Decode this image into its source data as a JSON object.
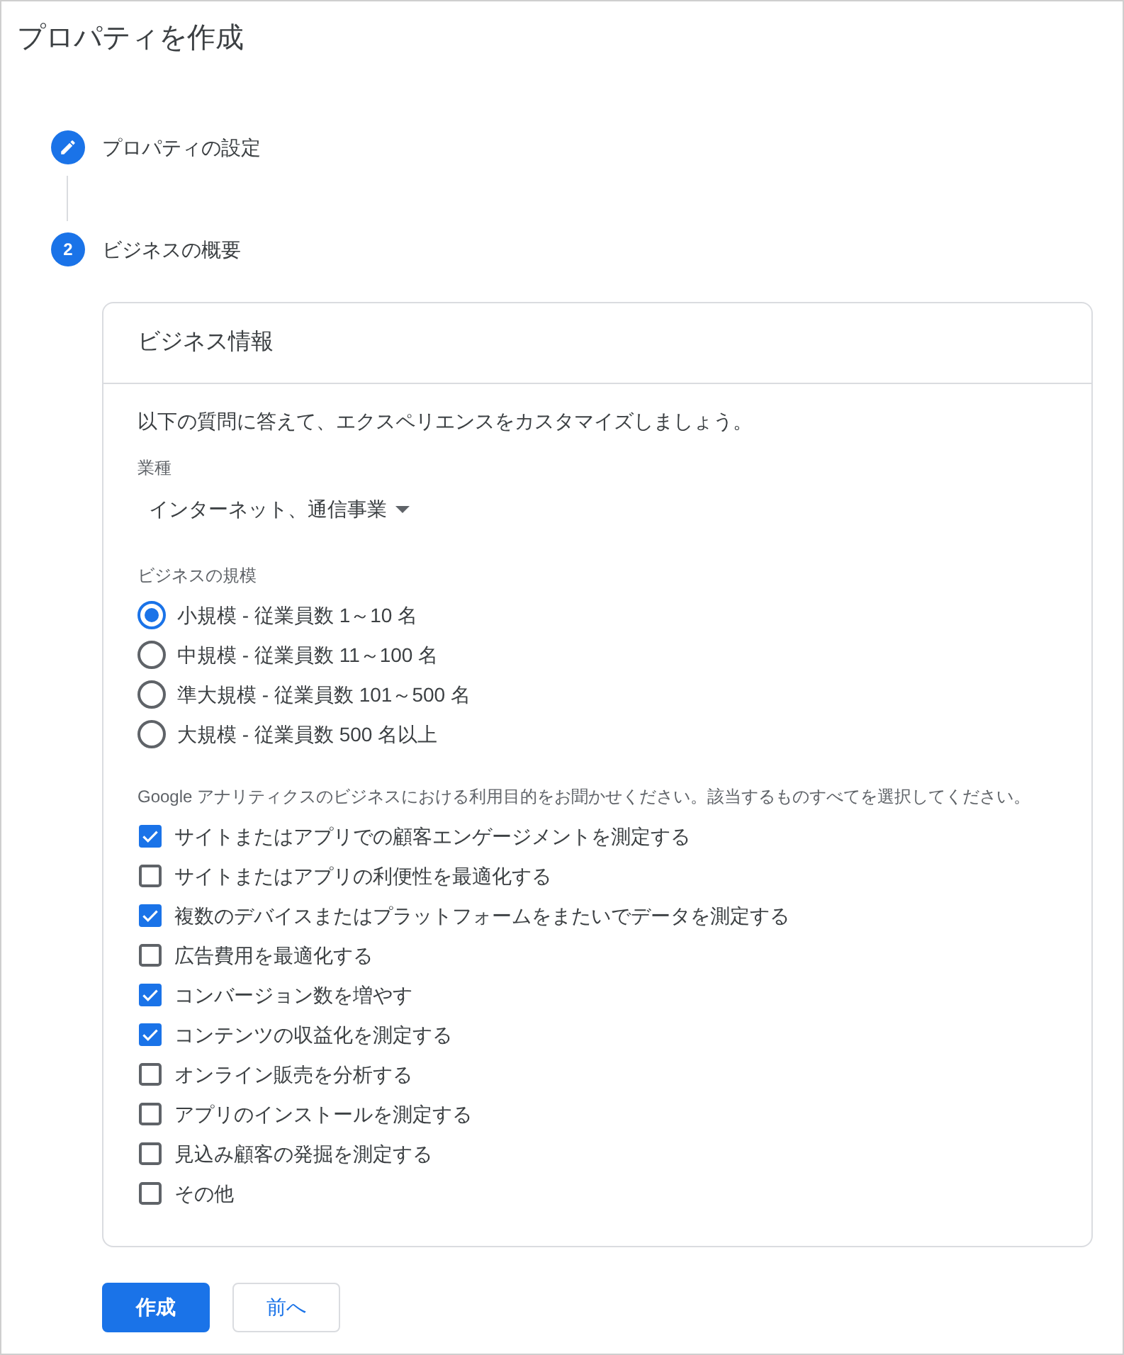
{
  "title": "プロパティを作成",
  "steps": [
    {
      "kind": "edit",
      "label": "プロパティの設定"
    },
    {
      "kind": "number",
      "number": "2",
      "label": "ビジネスの概要"
    }
  ],
  "card": {
    "title": "ビジネス情報",
    "intro": "以下の質問に答えて、エクスペリエンスをカスタマイズしましょう。",
    "industry": {
      "label": "業種",
      "value": "インターネット、通信事業"
    },
    "business_size": {
      "label": "ビジネスの規模",
      "options": [
        {
          "label": "小規模 - 従業員数 1～10 名",
          "selected": true
        },
        {
          "label": "中規模 - 従業員数 11～100 名",
          "selected": false
        },
        {
          "label": "準大規模 - 従業員数 101～500 名",
          "selected": false
        },
        {
          "label": "大規模 - 従業員数 500 名以上",
          "selected": false
        }
      ]
    },
    "purposes": {
      "label": "Google アナリティクスのビジネスにおける利用目的をお聞かせください。該当するものすべてを選択してください。",
      "options": [
        {
          "label": "サイトまたはアプリでの顧客エンゲージメントを測定する",
          "checked": true
        },
        {
          "label": "サイトまたはアプリの利便性を最適化する",
          "checked": false
        },
        {
          "label": "複数のデバイスまたはプラットフォームをまたいでデータを測定する",
          "checked": true
        },
        {
          "label": "広告費用を最適化する",
          "checked": false
        },
        {
          "label": "コンバージョン数を増やす",
          "checked": true
        },
        {
          "label": "コンテンツの収益化を測定する",
          "checked": true
        },
        {
          "label": "オンライン販売を分析する",
          "checked": false
        },
        {
          "label": "アプリのインストールを測定する",
          "checked": false
        },
        {
          "label": "見込み顧客の発掘を測定する",
          "checked": false
        },
        {
          "label": "その他",
          "checked": false
        }
      ]
    }
  },
  "buttons": [
    {
      "kind": "primary",
      "label": "作成"
    },
    {
      "kind": "secondary",
      "label": "前へ"
    }
  ]
}
